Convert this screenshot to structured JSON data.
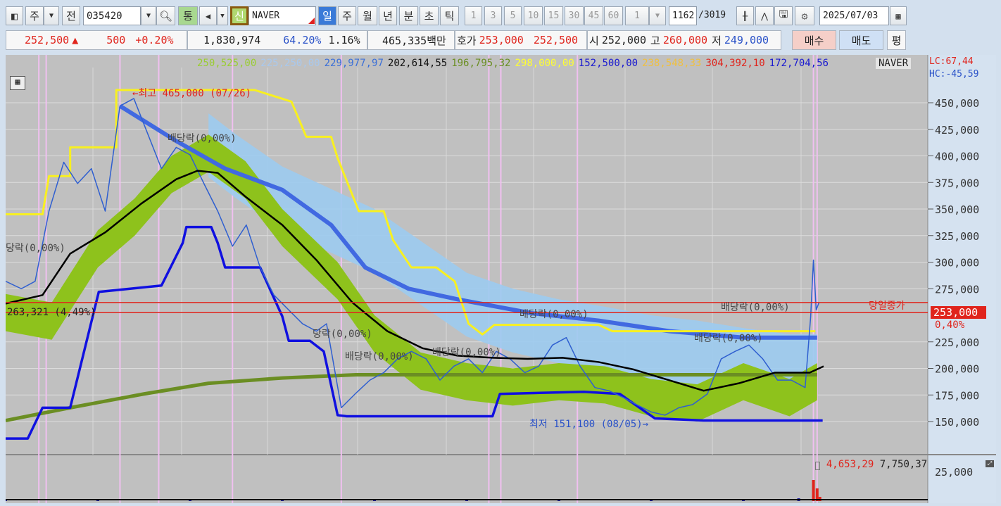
{
  "toolbar": {
    "market": "주",
    "all": "전",
    "code": "035420",
    "unified": "통",
    "new": "신",
    "name": "NAVER",
    "periods": [
      "일",
      "주",
      "월",
      "년",
      "분",
      "초",
      "틱"
    ],
    "minutes": [
      "1",
      "3",
      "5",
      "10",
      "15",
      "30",
      "45",
      "60"
    ],
    "step": "1",
    "count": "1162",
    "total": "/3019",
    "date": "2025/07/03"
  },
  "quote": {
    "price": "252,500",
    "arrow": "▲",
    "change": "500",
    "change_pct": "+0.20%",
    "volume": "1,830,974",
    "ratio1": "64.20%",
    "ratio2": "1.16%",
    "amount": "465,335백만",
    "hoga_label": "호가",
    "ask": "253,000",
    "bid": "252,500",
    "open_label": "시",
    "open": "252,000",
    "high_label": "고",
    "high": "260,000",
    "low_label": "저",
    "low": "249,000",
    "buy": "매수",
    "sell": "매도",
    "eval": "평"
  },
  "legend": [
    {
      "text": "250,525,00",
      "color": "#9acd32"
    },
    {
      "text": "225,250,00",
      "color": "#a8c8ee"
    },
    {
      "text": "229,977,97",
      "color": "#3a6fd8"
    },
    {
      "text": "202,614,55",
      "color": "#111111"
    },
    {
      "text": "196,795,32",
      "color": "#6b8e23"
    },
    {
      "text": "298,000,00",
      "color": "#ffff30"
    },
    {
      "text": "152,500,00",
      "color": "#1a1ad0"
    },
    {
      "text": "238,548,33",
      "color": "#f0c040"
    },
    {
      "text": "304,392,10",
      "color": "#e0241c"
    },
    {
      "text": "172,704,56",
      "color": "#1a1ad0"
    }
  ],
  "legend_name": "NAVER",
  "lc": "LC:67,44",
  "hc": "HC:-45,59",
  "annotations": {
    "high": "←최고 465,000 (07/26)",
    "low": "최저 151,100 (08/05)→",
    "div1": "배당락(0,00%)",
    "div2": "당락(0,00%)",
    "div3": "당락(0,00%)",
    "div4": "배당락(0,00%)",
    "div5": "배당락(0,00%)",
    "div6": "배당락(0,00%)",
    "div7": "배당락(0,00%)",
    "div8": "배당락(0,00%)",
    "line_label": "263,321 (4,49%)",
    "close_label": "당일종가",
    "current": "253,000",
    "current_pct": "0,40%"
  },
  "volume_legend": {
    "v1": "4,653,29",
    "v2": "7,750,37"
  },
  "chart_data": {
    "type": "line",
    "ylim": [
      130000,
      470000
    ],
    "x_range": [
      0,
      100
    ],
    "y_ticks": [
      "450,000",
      "425,000",
      "400,000",
      "375,000",
      "350,000",
      "325,000",
      "300,000",
      "275,000",
      "225,000",
      "200,000",
      "175,000",
      "150,000"
    ],
    "y_tick_values": [
      450000,
      425000,
      400000,
      375000,
      350000,
      325000,
      300000,
      275000,
      225000,
      200000,
      175000,
      150000
    ],
    "volume_tick": "25,000",
    "hlines": [
      {
        "value": 262000,
        "color": "#e0241c"
      },
      {
        "value": 252500,
        "color": "#e0241c"
      }
    ],
    "event_x": [
      3.6,
      4.4,
      12.4,
      16.6,
      24.6,
      36.4,
      52.4,
      53.7,
      62,
      87.6,
      88
    ],
    "series": [
      {
        "name": "cloud-upper",
        "color": "#9ccbf0",
        "width": 0,
        "x": [
          22,
          25,
          30,
          35,
          40,
          45,
          50,
          55,
          60,
          65,
          70,
          75,
          80,
          85,
          88
        ],
        "y": [
          440,
          420,
          390,
          370,
          350,
          320,
          290,
          275,
          265,
          258,
          250,
          245,
          238,
          232,
          232
        ]
      },
      {
        "name": "green-band",
        "color": "#8ec21c",
        "width": 9,
        "x": [
          0,
          5,
          10,
          14,
          18,
          22,
          26,
          30,
          36,
          40,
          45,
          50,
          55,
          60,
          65,
          70,
          75,
          80,
          85,
          88
        ],
        "y": [
          270,
          262,
          330,
          360,
          400,
          420,
          395,
          350,
          300,
          250,
          215,
          205,
          200,
          205,
          202,
          190,
          185,
          205,
          190,
          205
        ]
      },
      {
        "name": "olive-ma",
        "color": "#6b8e23",
        "width": 5,
        "x": [
          0,
          7,
          15,
          22,
          30,
          38,
          45,
          53,
          61,
          68,
          76,
          88
        ],
        "y": [
          151,
          163,
          176,
          186,
          191,
          194,
          194,
          194,
          194,
          194,
          194,
          194
        ]
      },
      {
        "name": "thick-blue-ma",
        "color": "#4169e1",
        "width": 6,
        "x": [
          12.4,
          18.5,
          23.8,
          30,
          35.3,
          39,
          43.7,
          49,
          57,
          64.3,
          72,
          80,
          88
        ],
        "y": [
          447,
          414,
          388,
          368,
          335,
          295,
          275,
          265,
          252,
          245,
          235,
          229,
          229
        ]
      },
      {
        "name": "yellow-stair",
        "color": "#f8f020",
        "width": 3,
        "x": [
          0,
          4,
          4.7,
          7,
          7,
          12,
          12,
          27,
          31,
          32.6,
          35.3,
          36,
          38.3,
          41,
          42,
          44,
          46.7,
          48.7,
          50.2,
          51.7,
          53,
          64.3,
          65.8,
          75.7,
          87.8
        ],
        "y": [
          345,
          345,
          381,
          381,
          408,
          408,
          462,
          462,
          451,
          418,
          418,
          398,
          348,
          348,
          321,
          295,
          295,
          282,
          242,
          232,
          241,
          241,
          235,
          235,
          235
        ]
      },
      {
        "name": "blue-stair",
        "color": "#1010e0",
        "width": 3.5,
        "x": [
          0,
          2.4,
          4,
          7,
          10.1,
          16.9,
          19.2,
          19.6,
          22.3,
          23,
          23.8,
          27.6,
          30,
          30.7,
          33,
          34.5,
          36,
          37,
          52.8,
          53.6,
          62.7,
          66.6,
          70.4,
          75.7,
          88.6
        ],
        "y": [
          134,
          134,
          163,
          163,
          272,
          278,
          318,
          333,
          333,
          318,
          295,
          295,
          249,
          226,
          226,
          216,
          156,
          155,
          155,
          176,
          178,
          176,
          153,
          151,
          151
        ]
      },
      {
        "name": "price-line",
        "color": "#2f5fd0",
        "width": 1.5,
        "x": [
          0,
          1.7,
          3.2,
          4.7,
          6.3,
          7.8,
          9.3,
          10.8,
          12.4,
          13.9,
          15.4,
          16.9,
          18.5,
          20,
          21.5,
          23,
          24.6,
          26.1,
          27.6,
          29.1,
          30.7,
          32.2,
          33.7,
          34.8,
          36.4,
          37.9,
          39.5,
          41,
          42.5,
          44,
          45.6,
          47.1,
          48.6,
          50.2,
          51.7,
          53.2,
          54.7,
          56.3,
          57.8,
          59.3,
          60.8,
          62.3,
          63.9,
          65.4,
          66.9,
          68.4,
          70,
          71.5,
          73,
          74.5,
          76.1,
          77.6,
          79.1,
          80.6,
          82.1,
          83.7,
          85.2,
          86.7,
          87.3,
          87.6,
          87.9,
          88.2
        ],
        "y": [
          282,
          275,
          282,
          348,
          394,
          374,
          388,
          348,
          447,
          454,
          421,
          388,
          408,
          401,
          374,
          348,
          315,
          335,
          295,
          269,
          255,
          242,
          235,
          242,
          163,
          176,
          189,
          196,
          209,
          216,
          209,
          189,
          202,
          209,
          196,
          216,
          209,
          196,
          202,
          222,
          229,
          202,
          182,
          179,
          173,
          166,
          159,
          156,
          163,
          166,
          176,
          209,
          216,
          222,
          209,
          189,
          189,
          182,
          249,
          302,
          255,
          262
        ]
      },
      {
        "name": "black-ma",
        "color": "#000000",
        "width": 2.5,
        "x": [
          0,
          4,
          7,
          10.8,
          14.7,
          18.5,
          20.8,
          23,
          26.1,
          30,
          33.7,
          37.6,
          41.4,
          45.2,
          49,
          52.8,
          56.6,
          60.4,
          64.3,
          68.1,
          71.9,
          75.7,
          79.5,
          83.4,
          87.2,
          88.7
        ],
        "y": [
          261,
          269,
          308,
          328,
          355,
          378,
          386,
          384,
          361,
          335,
          302,
          262,
          235,
          219,
          212,
          210,
          209,
          210,
          206,
          199,
          189,
          179,
          186,
          196,
          196,
          202
        ]
      }
    ],
    "volume": {
      "x": [
        0,
        10,
        20,
        30,
        40,
        50,
        60,
        70,
        80,
        86,
        87.6,
        88,
        88.3
      ],
      "y": [
        2,
        3,
        2,
        3,
        2,
        2,
        2,
        2,
        3,
        4,
        30,
        18,
        6
      ]
    }
  }
}
